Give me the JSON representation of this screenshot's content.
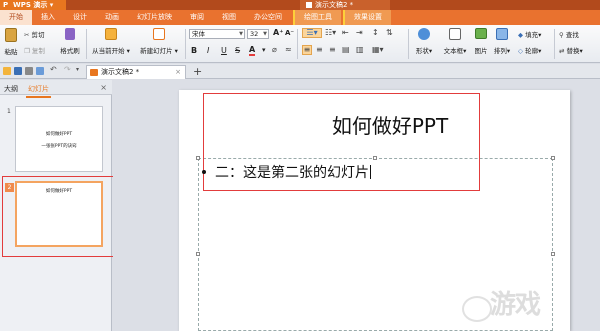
{
  "app": {
    "name": "WPS 演示",
    "doc_title": "演示文稿2 *"
  },
  "menu": {
    "tabs": [
      "开始",
      "插入",
      "设计",
      "动画",
      "幻灯片放映",
      "审阅",
      "视图",
      "办公空间"
    ],
    "tool_tabs": [
      "绘图工具",
      "效果设置"
    ]
  },
  "ribbon": {
    "paste": "粘贴",
    "cut": "剪切",
    "copy": "复制",
    "format_painter": "格式刷",
    "from_current": "从当前开始",
    "new_slide": "新建幻灯片",
    "font_name": "宋体",
    "font_size": "32",
    "bold": "B",
    "italic": "I",
    "underline": "U",
    "strike": "S",
    "font_color": "A",
    "shape": "形状",
    "textbox": "文本框",
    "picture": "图片",
    "arrange": "排列",
    "fill": "填充",
    "outline": "轮廓",
    "find": "查找",
    "replace": "替换"
  },
  "doc_tab": {
    "label": "演示文稿2 *"
  },
  "left_pane": {
    "tab_outline": "大纲",
    "tab_slides": "幻灯片",
    "slides": [
      {
        "num": "1",
        "title": "如何做好PPT",
        "subtitle": "一张张PPT的诀窍"
      },
      {
        "num": "2",
        "title": "如何做好PPT"
      }
    ]
  },
  "slide": {
    "title": "如何做好PPT",
    "body": "二：这是第二张的幻灯片"
  },
  "watermark": "游戏"
}
